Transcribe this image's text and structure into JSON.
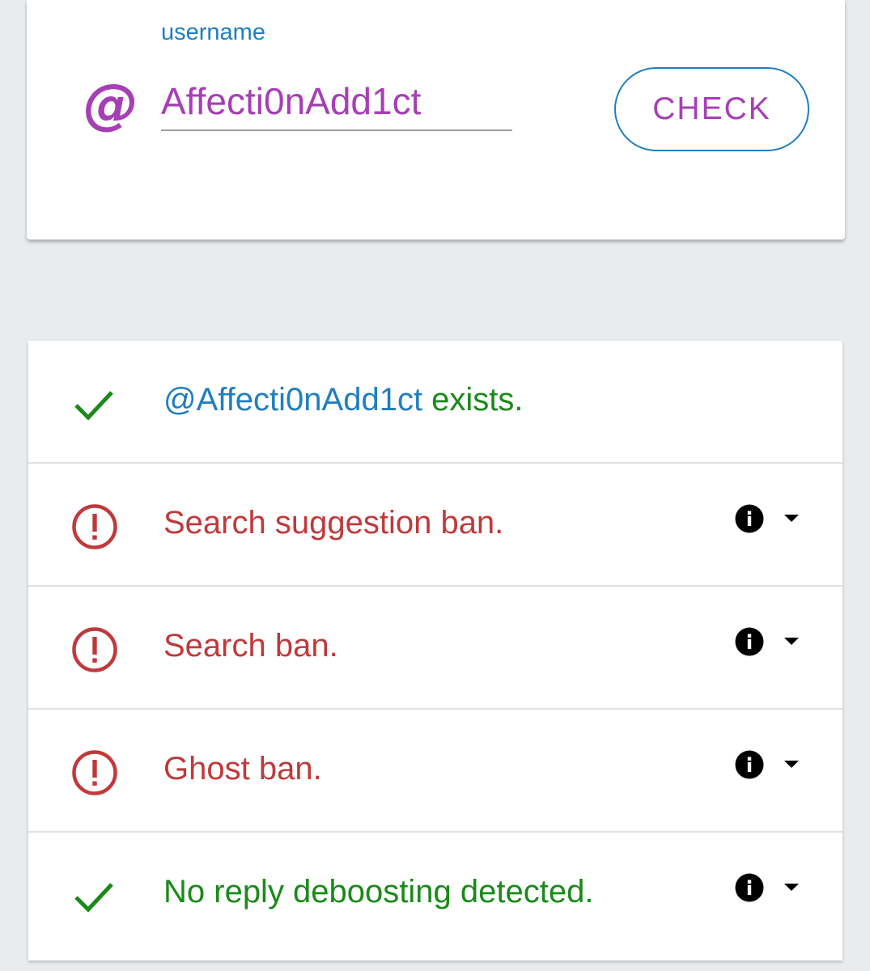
{
  "form": {
    "label": "username",
    "at_symbol": "@",
    "value": "Affecti0nAdd1ct",
    "button_label": "CHECK"
  },
  "results": [
    {
      "status": "ok",
      "icon": "checkmark-icon",
      "handle": "@Affecti0nAdd1ct",
      "text": " exists.",
      "has_details": false
    },
    {
      "status": "warning",
      "icon": "alert-circle-icon",
      "text": "Search suggestion ban.",
      "has_details": true
    },
    {
      "status": "warning",
      "icon": "alert-circle-icon",
      "text": "Search ban.",
      "has_details": true
    },
    {
      "status": "warning",
      "icon": "alert-circle-icon",
      "text": "Ghost ban.",
      "has_details": true
    },
    {
      "status": "ok",
      "icon": "checkmark-icon",
      "text": "No reply deboosting detected.",
      "has_details": true
    }
  ],
  "colors": {
    "accent_purple": "#a63fb5",
    "accent_blue": "#1f7fbf",
    "ok_green": "#1a8a1a",
    "error_red": "#c0393b"
  }
}
